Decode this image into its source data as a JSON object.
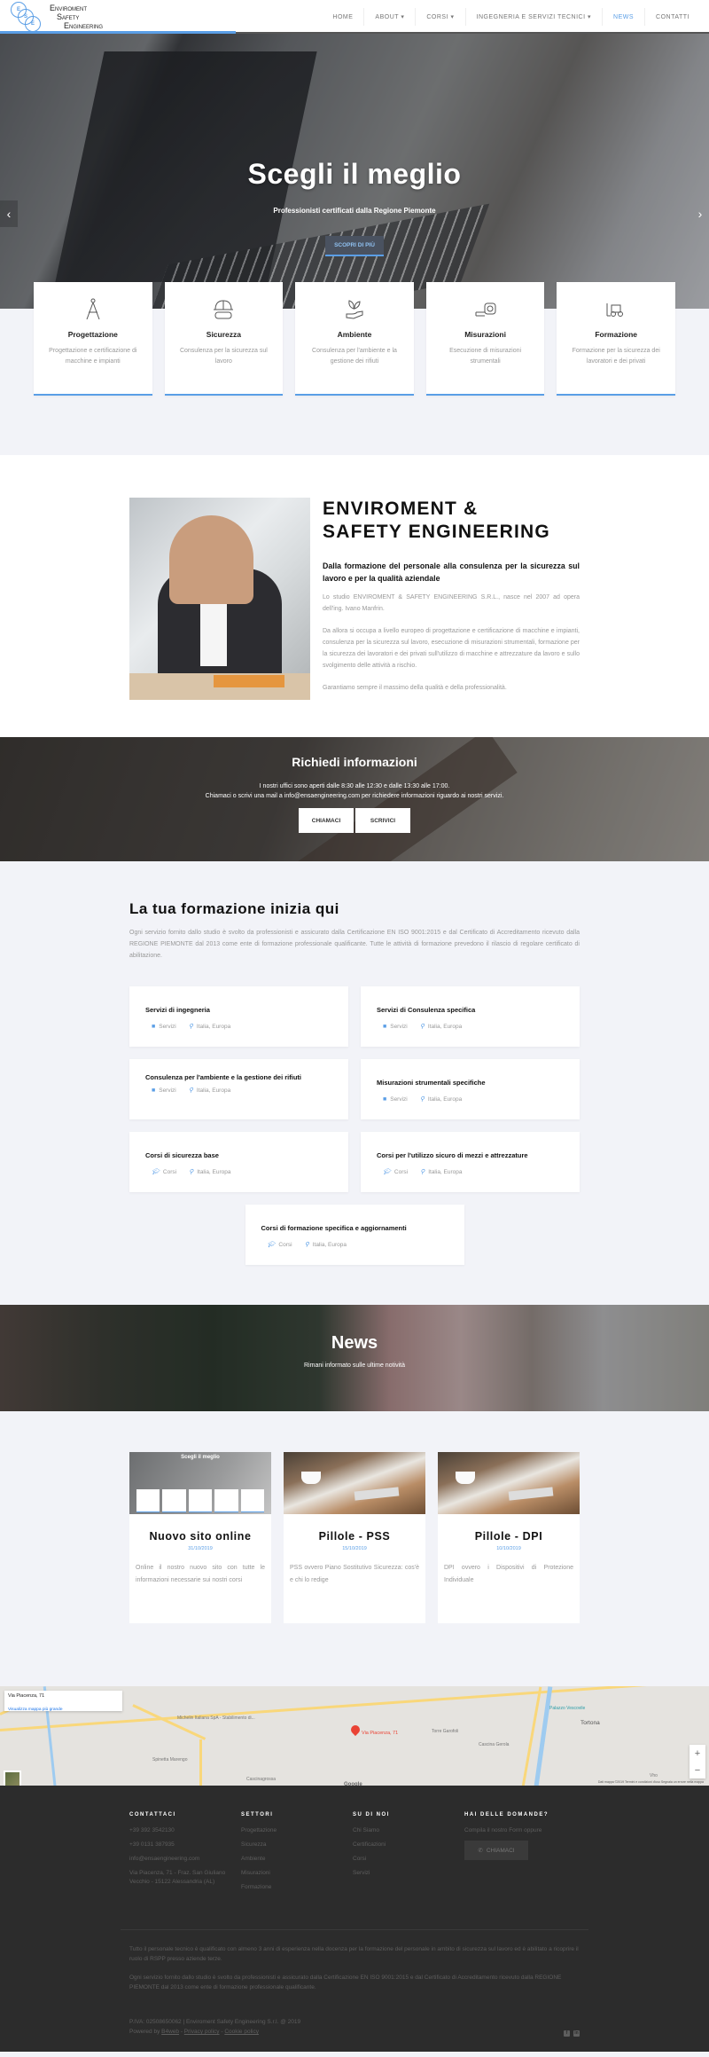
{
  "header": {
    "logo_lines": [
      "Enviroment",
      "Safety",
      "Engineering"
    ],
    "logo_letters": [
      "E",
      "S",
      "E"
    ],
    "nav": [
      {
        "label": "HOME",
        "active": false
      },
      {
        "label": "ABOUT ▾",
        "active": false
      },
      {
        "label": "CORSI ▾",
        "active": false
      },
      {
        "label": "INGEGNERIA E SERVIZI TECNICI ▾",
        "active": false
      },
      {
        "label": "NEWS",
        "active": true
      },
      {
        "label": "CONTATTI",
        "active": false
      }
    ]
  },
  "hero": {
    "title": "Scegli il meglio",
    "subtitle": "Professionisti certificati dalla Regione Piemonte",
    "button": "SCOPRI DI PIÙ",
    "prev_icon": "‹",
    "next_icon": "›"
  },
  "features": [
    {
      "icon": "compass-icon",
      "title": "Progettazione",
      "desc": "Progettazione e certificazione di macchine e impianti"
    },
    {
      "icon": "helmet-goggles-icon",
      "title": "Sicurezza",
      "desc": "Consulenza per la sicurezza sul lavoro"
    },
    {
      "icon": "leaf-hand-icon",
      "title": "Ambiente",
      "desc": "Consulenza per l'ambiente e la gestione dei rifiuti"
    },
    {
      "icon": "tape-measure-icon",
      "title": "Misurazioni",
      "desc": "Esecuzione di misurazioni strumentali"
    },
    {
      "icon": "forklift-icon",
      "title": "Formazione",
      "desc": "Formazione per la sicurezza dei lavoratori e dei privati"
    }
  ],
  "about": {
    "title_line1": "ENVIROMENT &",
    "title_line2": "SAFETY ENGINEERING",
    "lead": "Dalla formazione del personale alla consulenza per la sicurezza sul lavoro e per la qualità aziendale",
    "paragraphs": [
      "Lo studio ENVIROMENT & SAFETY ENGINEERING S.R.L., nasce nel 2007 ad opera dell'ing. Ivano Manfrin.",
      "Da allora si occupa a livello europeo di progettazione e certificazione di macchine e impianti, consulenza per la sicurezza sul lavoro, esecuzione di misurazioni strumentali, formazione per la sicurezza dei lavoratori e dei privati sull'utilizzo di macchine e attrezzature da lavoro e sullo svolgimento delle attività a rischio.",
      "Garantiamo sempre il massimo della qualità e della professionalità."
    ]
  },
  "cta": {
    "title": "Richiedi informazioni",
    "line1": "I nostri uffici sono aperti dalle 8:30 alle 12:30 e dalle 13:30 alle 17:00.",
    "line2": "Chiamaci o scrivi una mail a info@ensaengineering.com per richiedere informazioni riguardo ai nostri servizi.",
    "call_button": "CHIAMACI",
    "write_button": "SCRIVICI"
  },
  "services": {
    "title": "La tua formazione inizia qui",
    "desc": "Ogni servizio fornito dallo studio è svolto da professionisti e assicurato dalla Certificazione EN ISO 9001:2015 e dal Certificato di Accreditamento ricevuto dalla REGIONE PIEMONTE dal 2013 come ente di formazione professionale qualificante. Tutte le attività di formazione prevedono il rilascio di regolare certificato di abilitazione.",
    "items": [
      {
        "name": "Servizi di ingegneria",
        "category": "Servizi",
        "category_icon": "briefcase-icon",
        "location": "Italia, Europa"
      },
      {
        "name": "Servizi di Consulenza specifica",
        "category": "Servizi",
        "category_icon": "briefcase-icon",
        "location": "Italia, Europa"
      },
      {
        "name": "Consulenza per l'ambiente e la gestione dei rifiuti",
        "category": "Servizi",
        "category_icon": "briefcase-icon",
        "location": "Italia, Europa"
      },
      {
        "name": "Misurazioni strumentali specifiche",
        "category": "Servizi",
        "category_icon": "briefcase-icon",
        "location": "Italia, Europa"
      },
      {
        "name": "Corsi di sicurezza base",
        "category": "Corsi",
        "category_icon": "graduation-cap-icon",
        "location": "Italia, Europa"
      },
      {
        "name": "Corsi per l'utilizzo sicuro di mezzi e attrezzature",
        "category": "Corsi",
        "category_icon": "graduation-cap-icon",
        "location": "Italia, Europa"
      },
      {
        "name": "Corsi di formazione specifica e aggiornamenti",
        "category": "Corsi",
        "category_icon": "graduation-cap-icon",
        "location": "Italia, Europa"
      }
    ]
  },
  "news_banner": {
    "title": "News",
    "subtitle": "Rimani informato sulle ultime notività"
  },
  "news": [
    {
      "title": "Nuovo sito online",
      "date": "31/10/2019",
      "excerpt": "Online il nostro nuovo sito con tutte le informazioni necessarie sui nostri corsi",
      "thumb": "site",
      "thumb_caption": "Scegli il meglio"
    },
    {
      "title": "Pillole - PSS",
      "date": "15/10/2019",
      "excerpt": "PSS ovvero Piano Sostitutivo Sicurezza: cos'è e chi lo redige",
      "thumb": "desk",
      "thumb_caption": ""
    },
    {
      "title": "Pillole - DPI",
      "date": "10/10/2019",
      "excerpt": "DPI ovvero i Dispositivi di Protezione Individuale",
      "thumb": "desk",
      "thumb_caption": ""
    }
  ],
  "map": {
    "address": "Via Piacenza, 71",
    "larger_map_link": "Visualizza mappa più grande",
    "pin_label": "Via Piacenza, 71",
    "labels": [
      "Michelin Italiana SpA - Stabilimento di...",
      "Spinetta Marengo",
      "Cascinagrossa",
      "Torre Garofoli",
      "Cascina Gerola",
      "Tortona",
      "Palazzo Vescovile",
      "Vho"
    ],
    "zoom_in": "+",
    "zoom_out": "−",
    "google": "Google",
    "terms": "Dati mappa ©2019   Termini e condizioni d'uso   Segnala un errore nella mappa"
  },
  "footer": {
    "contact": {
      "heading": "CONTATTACI",
      "phone1": "+39 392 3542130",
      "phone2": "+39 0131 387935",
      "email": "info@ensaengineering.com",
      "address": "Via Piacenza, 71 - Fraz. San Giuliano Vecchio - 15122 Alessandria (AL)"
    },
    "sectors": {
      "heading": "SETTORI",
      "items": [
        "Progettazione",
        "Sicurezza",
        "Ambiente",
        "Misurazioni",
        "Formazione"
      ]
    },
    "about": {
      "heading": "SU DI NOI",
      "items": [
        "Chi Siamo",
        "Certificazioni",
        "Corsi",
        "Servizi"
      ]
    },
    "questions": {
      "heading": "HAI DELLE DOMANDE?",
      "text": "Compila il nostro Form oppure",
      "button": "CHIAMACI"
    },
    "text1": "Tutto il personale tecnico è qualificato con almeno 3 anni di esperienza nella docenza per la formazione del personale in ambito di sicurezza sul lavoro ed è abilitato a ricoprire il ruolo di RSPP presso aziende terze.",
    "text2": "Ogni servizio fornito dallo studio è svolto da professionisti e assicurato dalla Certificazione EN ISO 9001:2015 e dal Certificato di Accreditamento ricevuto dalla REGIONE PIEMONTE dal 2013 come ente di formazione professionale qualificante.",
    "legal": "P.IVA: 02508650062 | Enviroment Safety Engineering S.r.l. @ 2019",
    "powered_prefix": "Powered by ",
    "powered_link": "B4web",
    "sep": " - ",
    "privacy": "Privacy policy",
    "cookie": "Cookie policy",
    "social": [
      "f",
      "in"
    ]
  },
  "colors": {
    "accent": "#5a9ee6",
    "background": "#f2f3f8",
    "footer": "#2c2c2c"
  }
}
